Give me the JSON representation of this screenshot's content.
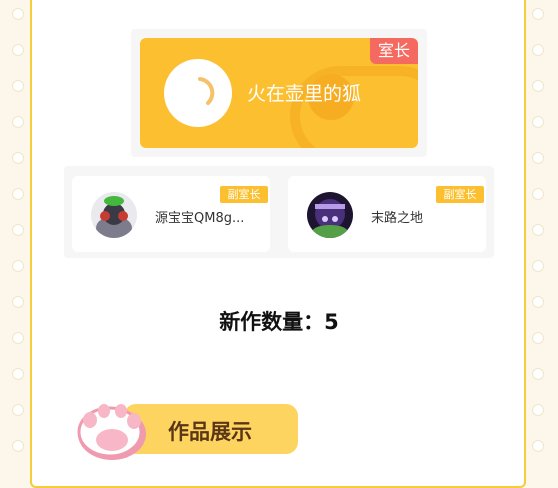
{
  "room": {
    "owner": {
      "name": "火在壶里的狐",
      "role": "室长",
      "avatar_icon": "loading-spinner-avatar"
    },
    "vice_owners": [
      {
        "name": "源宝宝QM8g...",
        "role": "副室长",
        "avatar_icon": "character-avatar"
      },
      {
        "name": "末路之地",
        "role": "副室长",
        "avatar_icon": "game-cover-avatar"
      }
    ],
    "new_works_count_label": "新作数量：5"
  },
  "section": {
    "works_title": "作品展示",
    "icon": "paw-icon"
  },
  "colors": {
    "accent_yellow": "#fbbf30",
    "badge_red": "#f46a61",
    "frame_border": "#f5cc3a"
  }
}
